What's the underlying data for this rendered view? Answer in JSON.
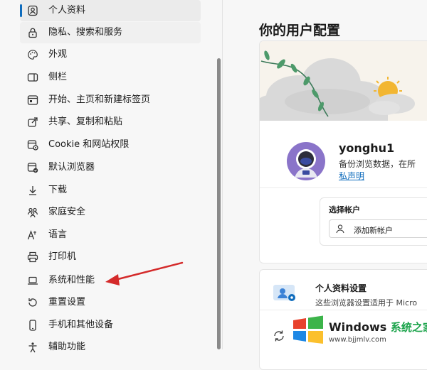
{
  "sidebar": {
    "items": [
      {
        "label": "个人资料",
        "icon": "profile-icon"
      },
      {
        "label": "隐私、搜索和服务",
        "icon": "lock-icon"
      },
      {
        "label": "外观",
        "icon": "palette-icon"
      },
      {
        "label": "侧栏",
        "icon": "sidebar-icon"
      },
      {
        "label": "开始、主页和新建标签页",
        "icon": "home-tabs-icon"
      },
      {
        "label": "共享、复制和粘贴",
        "icon": "share-icon"
      },
      {
        "label": "Cookie 和网站权限",
        "icon": "site-permissions-icon"
      },
      {
        "label": "默认浏览器",
        "icon": "default-browser-icon"
      },
      {
        "label": "下载",
        "icon": "download-icon"
      },
      {
        "label": "家庭安全",
        "icon": "family-icon"
      },
      {
        "label": "语言",
        "icon": "language-icon"
      },
      {
        "label": "打印机",
        "icon": "printer-icon"
      },
      {
        "label": "系统和性能",
        "icon": "laptop-icon"
      },
      {
        "label": "重置设置",
        "icon": "reset-icon"
      },
      {
        "label": "手机和其他设备",
        "icon": "phone-icon"
      },
      {
        "label": "辅助功能",
        "icon": "accessibility-icon"
      }
    ]
  },
  "main": {
    "title": "你的用户配置",
    "profile": {
      "username": "yonghu1",
      "sync_text": "备份浏览数据，在所",
      "privacy_link": "私声明"
    },
    "account": {
      "label": "选择帐户",
      "add_button": "添加新帐户"
    },
    "profile_settings": {
      "title": "个人资料设置",
      "description": "这些浏览器设置适用于 Micro"
    }
  },
  "watermark": {
    "brand": "Windows",
    "brand_cn": "系统之家",
    "url": "www.bjjmlv.com"
  },
  "colors": {
    "accent": "#0f6cbd",
    "arrow": "#d42a2a",
    "watermark_green": "#1aa34a"
  }
}
